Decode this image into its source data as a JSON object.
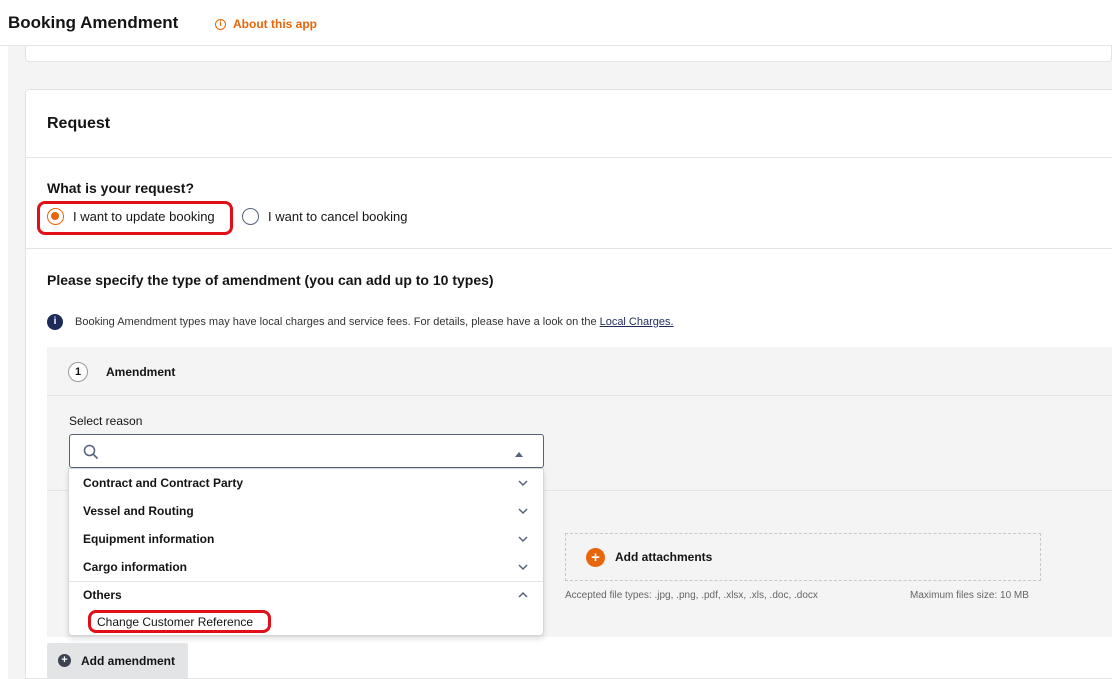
{
  "header": {
    "title": "Booking Amendment",
    "about_label": "About this app"
  },
  "request": {
    "title": "Request",
    "question": "What is your request?",
    "options": [
      {
        "label": "I want to update booking",
        "selected": true
      },
      {
        "label": "I want to cancel booking",
        "selected": false
      }
    ]
  },
  "amendment": {
    "section_title": "Please specify the type of amendment (you can add up to 10 types)",
    "notice_text": "Booking Amendment types may have local charges and service fees. For details, please have a look on the",
    "notice_link": "Local Charges.",
    "step_number": "1",
    "step_label": "Amendment",
    "select_label": "Select reason",
    "search_value": "",
    "dropdown": {
      "groups": [
        {
          "label": "Contract and Contract Party",
          "expanded": false
        },
        {
          "label": "Vessel and Routing",
          "expanded": false
        },
        {
          "label": "Equipment information",
          "expanded": false
        },
        {
          "label": "Cargo information",
          "expanded": false
        },
        {
          "label": "Others",
          "expanded": true
        }
      ],
      "sub_items": [
        "Change Customer Reference"
      ]
    },
    "attachments": {
      "button_label": "Add attachments",
      "file_types": "Accepted file types: .jpg, .png, .pdf, .xlsx, .xls, .doc, .docx",
      "max_size": "Maximum files size: 10 MB"
    },
    "add_button": "Add amendment"
  },
  "colors": {
    "accent": "#e8650a",
    "navy": "#1d2b5a",
    "highlight": "#e10f18"
  }
}
